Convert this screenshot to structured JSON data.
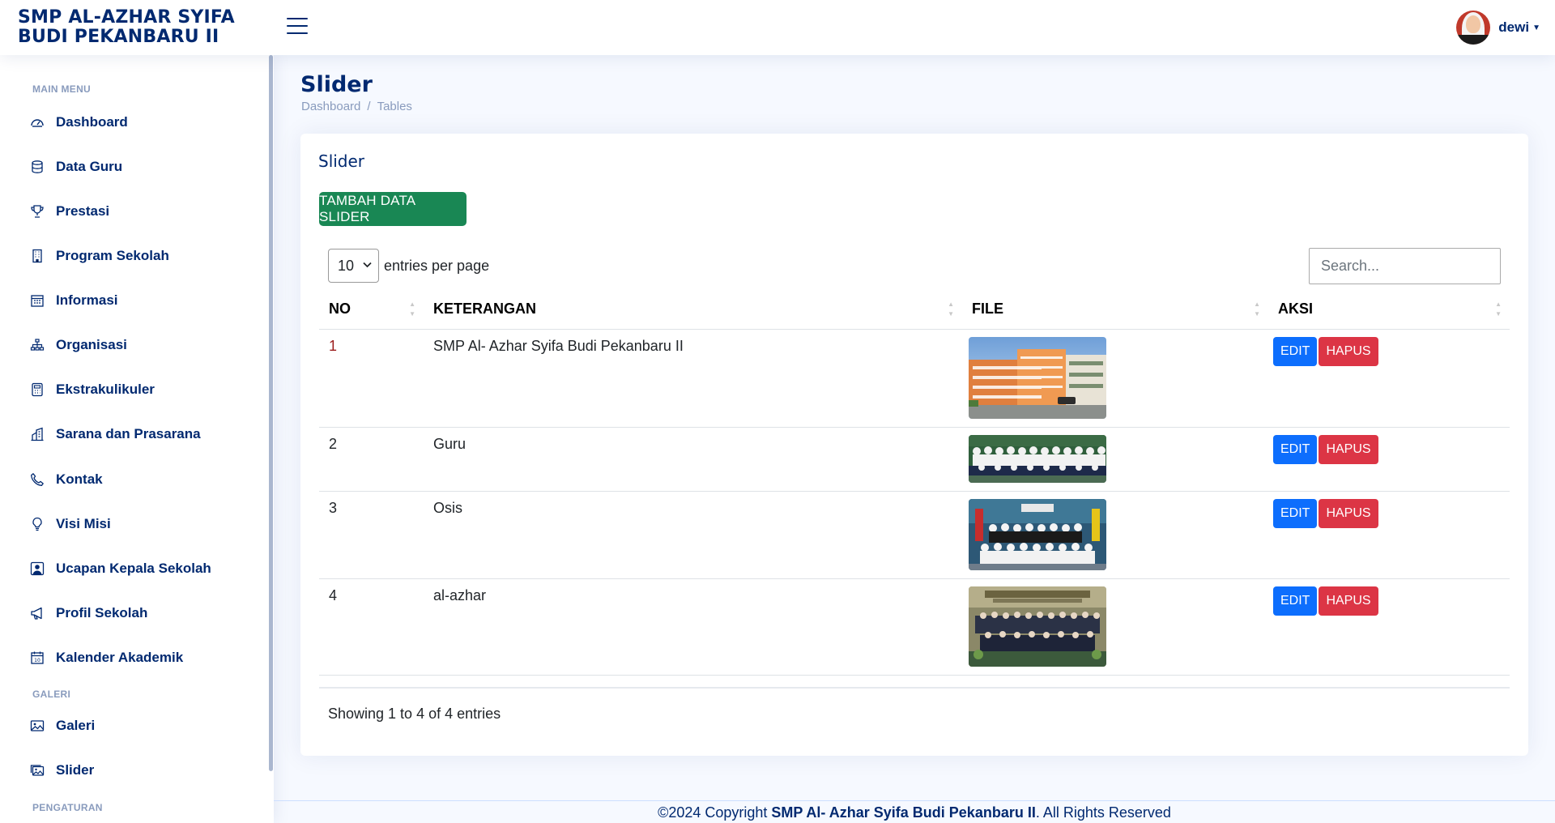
{
  "brand": {
    "line1": "SMP AL-AZHAR SYIFA",
    "line2": "BUDI PEKANBARU II"
  },
  "user": {
    "name": "dewi"
  },
  "sidebar": {
    "headings": {
      "main_menu": "MAIN MENU",
      "galeri": "GALERI",
      "pengaturan": "PENGATURAN"
    },
    "items": [
      {
        "label": "Dashboard",
        "icon": "speedometer-icon"
      },
      {
        "label": "Data Guru",
        "icon": "database-icon"
      },
      {
        "label": "Prestasi",
        "icon": "trophy-icon"
      },
      {
        "label": "Program Sekolah",
        "icon": "building-icon"
      },
      {
        "label": "Informasi",
        "icon": "calendar-grid-icon"
      },
      {
        "label": "Organisasi",
        "icon": "diagram-icon"
      },
      {
        "label": "Ekstrakulikuler",
        "icon": "calculator-icon"
      },
      {
        "label": "Sarana dan Prasarana",
        "icon": "buildings-icon"
      },
      {
        "label": "Kontak",
        "icon": "telephone-icon"
      },
      {
        "label": "Visi Misi",
        "icon": "lightbulb-icon"
      },
      {
        "label": "Ucapan Kepala Sekolah",
        "icon": "person-square-icon"
      },
      {
        "label": "Profil Sekolah",
        "icon": "megaphone-icon"
      },
      {
        "label": "Kalender Akademik",
        "icon": "calendar-icon"
      }
    ],
    "galeri_items": [
      {
        "label": "Galeri",
        "icon": "image-icon"
      },
      {
        "label": "Slider",
        "icon": "images-icon"
      }
    ]
  },
  "page": {
    "title": "Slider",
    "breadcrumb": [
      "Dashboard",
      "Tables"
    ],
    "breadcrumb_sep": "/"
  },
  "card": {
    "title": "Slider",
    "add_button": "TAMBAH DATA SLIDER",
    "entries_value": "10",
    "entries_suffix": "entries per page",
    "search_placeholder": "Search...",
    "columns": [
      "NO",
      "KETERANGAN",
      "FILE",
      "AKSI"
    ],
    "rows": [
      {
        "no": "1",
        "keterangan": "SMP Al- Azhar Syifa Budi Pekanbaru II",
        "image": "school-building-photo"
      },
      {
        "no": "2",
        "keterangan": "Guru",
        "image": "teachers-group-photo"
      },
      {
        "no": "3",
        "keterangan": "Osis",
        "image": "osis-group-photo"
      },
      {
        "no": "4",
        "keterangan": "al-azhar",
        "image": "al-azhar-event-photo"
      }
    ],
    "edit_label": "EDIT",
    "hapus_label": "HAPUS",
    "showing": "Showing 1 to 4 of 4 entries"
  },
  "footer": {
    "prefix": "©2024 Copyright ",
    "org": "SMP Al- Azhar Syifa Budi Pekanbaru II",
    "suffix": ". All Rights Reserved"
  },
  "colors": {
    "primary_text": "#012970",
    "success": "#198754",
    "edit": "#0d6efd",
    "delete": "#dc3545",
    "muted": "#899bbd"
  }
}
